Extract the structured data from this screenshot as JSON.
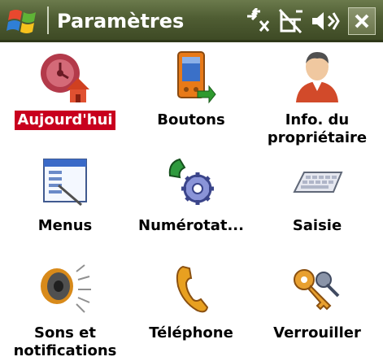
{
  "window": {
    "title": "Paramètres"
  },
  "status_icons": [
    "connectivity-icon",
    "phone-signal-off-icon",
    "volume-icon",
    "close-icon"
  ],
  "colors": {
    "titlebar": "#4f5d33",
    "selection": "#c8001e"
  },
  "items": [
    {
      "label": "Aujourd'hui",
      "icon": "today-house-icon",
      "selected": true
    },
    {
      "label": "Boutons",
      "icon": "buttons-device-icon",
      "selected": false
    },
    {
      "label": "Info. du\npropriétaire",
      "icon": "owner-info-icon",
      "selected": false
    },
    {
      "label": "Menus",
      "icon": "menus-window-icon",
      "selected": false
    },
    {
      "label": "Numérotat...",
      "icon": "dialing-gear-icon",
      "selected": false
    },
    {
      "label": "Saisie",
      "icon": "keyboard-input-icon",
      "selected": false
    },
    {
      "label": "Sons et\nnotifications",
      "icon": "speaker-sounds-icon",
      "selected": false
    },
    {
      "label": "Téléphone",
      "icon": "telephone-handset-icon",
      "selected": false
    },
    {
      "label": "Verrouiller",
      "icon": "lock-keys-icon",
      "selected": false
    }
  ]
}
